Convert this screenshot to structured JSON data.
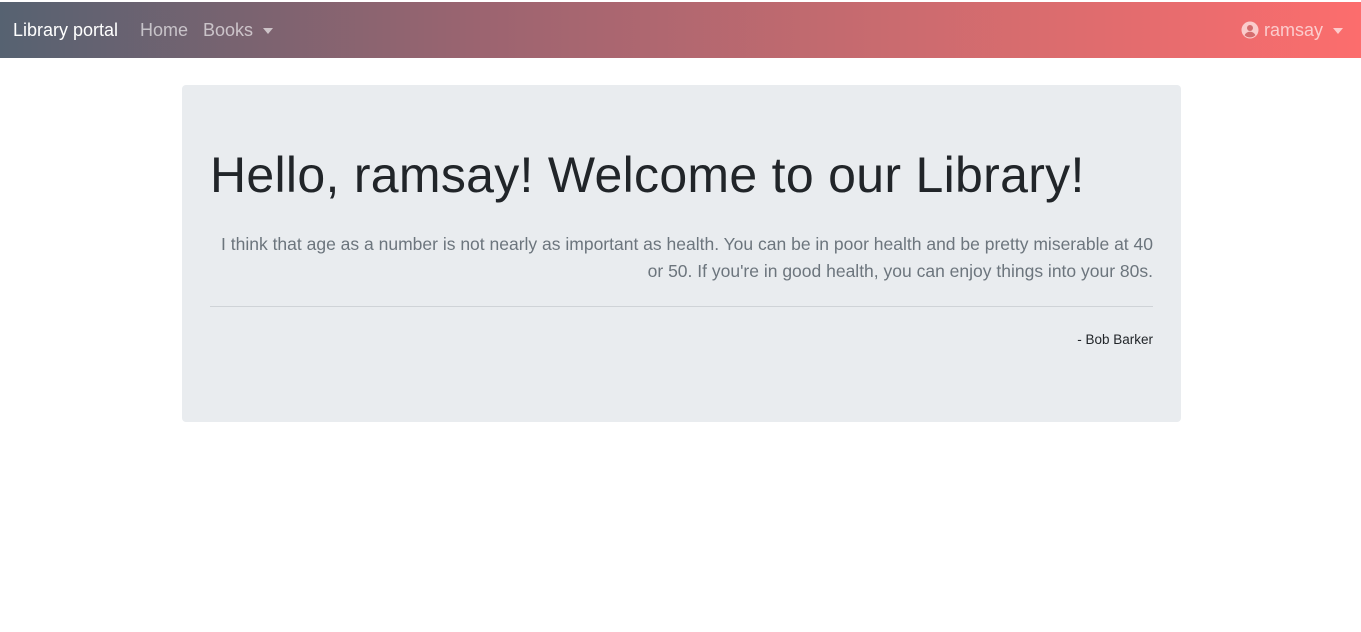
{
  "navbar": {
    "brand": "Library portal",
    "links": [
      {
        "label": "Home"
      },
      {
        "label": "Books"
      }
    ],
    "user": {
      "name": "ramsay",
      "icon": "user-circle-icon"
    }
  },
  "jumbotron": {
    "heading": "Hello, ramsay! Welcome to our Library!",
    "quote": "I think that age as a number is not nearly as important as health. You can be in poor health and be pretty miserable at 40 or 50. If you're in good health, you can enjoy things into your 80s.",
    "author": "- Bob Barker"
  },
  "colors": {
    "gradient_start": "#566271",
    "gradient_end": "#fc6d6d",
    "jumbotron_bg": "#e9ecef"
  }
}
